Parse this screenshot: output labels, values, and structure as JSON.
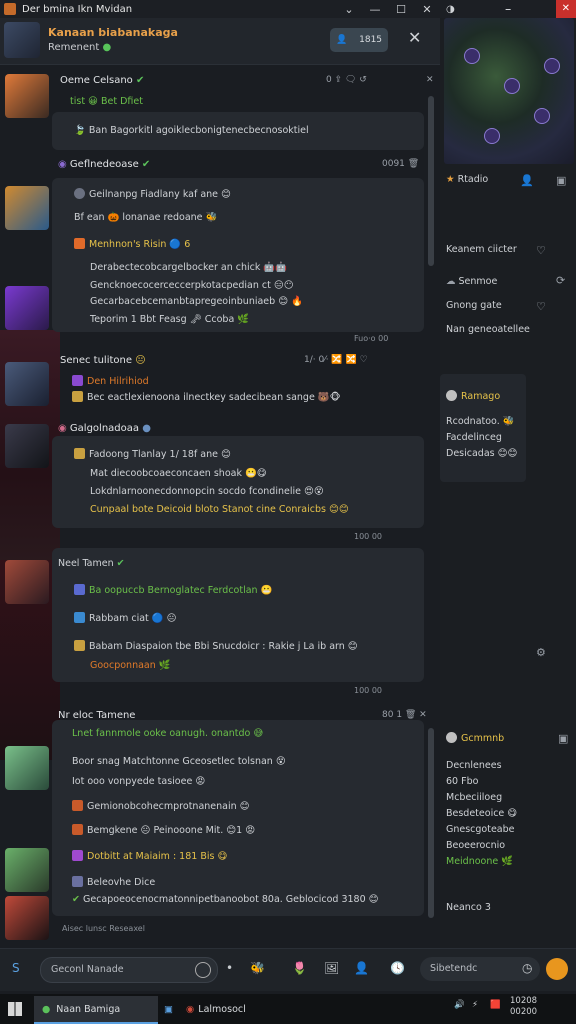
{
  "window": {
    "title": "Der bmina Ikn Mvidan",
    "controls": [
      "⌄",
      "—",
      "☐",
      "✕"
    ]
  },
  "chat_header": {
    "name": "Kanaan biabanakaga",
    "status": "Remenent",
    "pill_label": "1815",
    "close": "✕"
  },
  "messages": [
    {
      "sender": "Oeme Celsano",
      "lines": [
        "tist 😀 Bet Dfiet",
        "Ban Bagorkitl agoiklecbonigtenecbecnosoktiel"
      ],
      "tools": "0 ⇪ 🗨 ↺",
      "meta": "",
      "close": "✕"
    },
    {
      "sender": "Geflnedeoase",
      "lines": [
        "Geilnanpg Fiadlany kaf ane 😊",
        "Bf ean 🎃 lonanae redoane 🐝",
        "Menhnon's Risin 🔵 6",
        "Derabectecobcargelbocker an chick 🤖🤖",
        "Gencknoecocerceccerpkotacpedian ct 😑😶",
        "Gecarbacebcemanbtapregeoinbuniaeb 😊",
        "Teporim 1 Bbt Feasg 🗝 Ccoba 🌿"
      ],
      "tools": "0091 🗑",
      "meta": "Fuo·o 00"
    },
    {
      "sender": "Senec tulitone",
      "lines": [
        "Den Hilrihiod",
        "Bec eactlexienoona ilnectkey sadecibean sange 🐻🐵"
      ],
      "tools": "1/· 0⁄· 🔀 🔀 ♡",
      "meta": ""
    },
    {
      "sender": "Galgolnadoaa",
      "lines": [
        "Fadoong Tlanlay 1/ 18f ane 😊",
        "Mat diecoobcoaeconcaen shoak 😬😋",
        "Lokdnlarnoonecdonnopcin socdo fcondinelie 😍😵",
        "Cunpaal bote Deicoid bloto Stanot cine Conraicbs 😊😊"
      ],
      "tools": "",
      "meta": "100 00"
    },
    {
      "sender": "Neel Tamen",
      "lines": [
        "Ba oopuccb Bernoglatec Ferdcotlan 😬",
        "Rabbam ciat 🔵 😐",
        "Babam Diaspaion tbe Bbi Snucdoicr : Rakie j La ib arn 😊",
        "Goocponnaan 🌿"
      ],
      "tools": "",
      "meta": "100 00"
    },
    {
      "sender": "Nr eloc Tamene",
      "lines": [
        "Lnet fannmole ooke oanugh. onantdo 😅",
        "Boor snag Matchtonne Gceosetlec tolsnan 😵",
        "Iot ooo vonpyede tasioee 😡",
        "Gemionobcohecmprotnanenain 😊",
        "Bemgkene 😐 Peinooone Mit. 😊1 😡",
        "Dotbitt at Maiaim : 181 Bis 😋",
        "Beleovhe Dice",
        "Gecapoeocenocmatonnipetbanoobot 80a. Geblocicod 3180 😊"
      ],
      "tools": "80 1 🗑 ✕",
      "meta": "Aisec lunsc Reseaxel"
    }
  ],
  "right_panel": {
    "win_controls": [
      "◑",
      "⎯",
      "✕"
    ],
    "cards": [
      {
        "title": "Rtadio",
        "icon": "👤"
      },
      {
        "title": "Keanem ciicter",
        "icon": "♡"
      },
      {
        "title": "Senmoe",
        "icon": "⟳"
      },
      {
        "title": "Gnong gate",
        "icon": "♡"
      },
      {
        "title": "Nan geneoatellee"
      },
      {
        "title": "Ramago",
        "lines": [
          "Rcodnatoo. 🐝",
          "Facdelinceg",
          "Desicadas 😊😊"
        ]
      },
      {
        "title": "Gcmmnb",
        "lines": [
          "Decnlenees",
          "60 Fbo",
          "Mcbeciiloeg",
          "Besdeteoice 😋",
          "Gnescgoteabe",
          "Beoeerocnio",
          "Meidnoone 🌿"
        ],
        "footer": "Neanco 3"
      }
    ]
  },
  "input": {
    "placeholder": "Geconl Nanade",
    "placeholder2": "Sibetendc",
    "icons": [
      "🐝",
      "🌷",
      "🖼",
      "👤",
      "🕓"
    ]
  },
  "taskbar": {
    "tasks": [
      "Naan Bamiga",
      "Lalmosocl"
    ],
    "tray": [
      "🔊",
      "⚡",
      "🟥"
    ],
    "clock": [
      "10208",
      "00200"
    ]
  }
}
